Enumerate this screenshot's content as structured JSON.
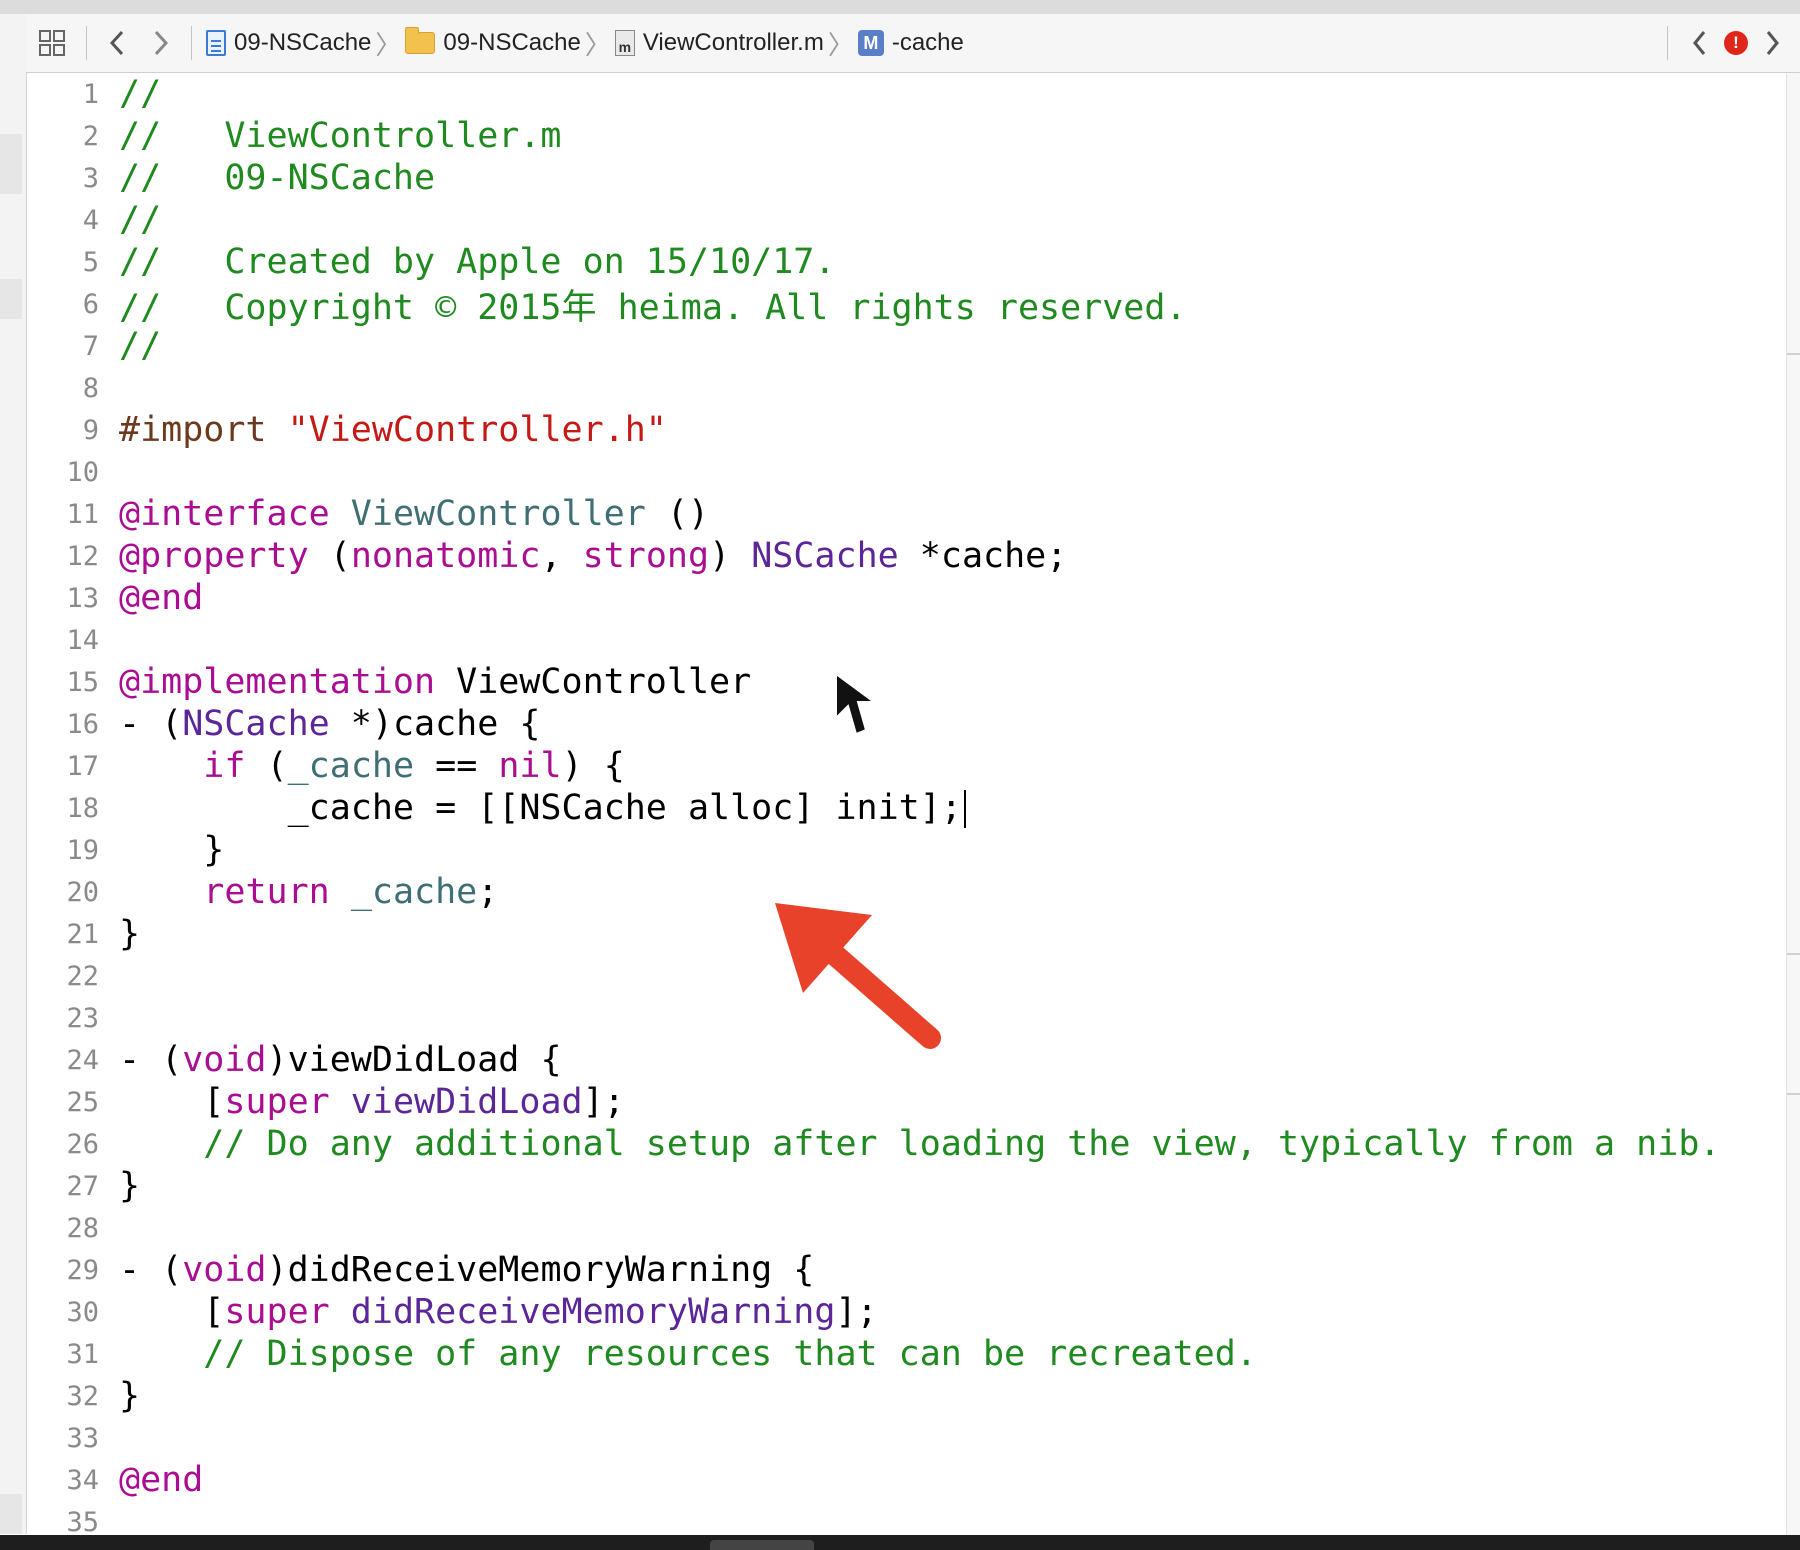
{
  "jumpbar": {
    "crumbs": [
      {
        "label": "09-NSCache",
        "icon": "project-file-icon"
      },
      {
        "label": "09-NSCache",
        "icon": "folder-icon"
      },
      {
        "label": "ViewController.m",
        "icon": "m-file-icon",
        "icon_glyph": "m"
      },
      {
        "label": "-cache",
        "icon": "method-icon",
        "icon_glyph": "M"
      }
    ],
    "error_glyph": "!"
  },
  "editor": {
    "lines": [
      {
        "n": "1",
        "tokens": [
          [
            "com",
            "//"
          ]
        ]
      },
      {
        "n": "2",
        "tokens": [
          [
            "com",
            "//   ViewController.m"
          ]
        ]
      },
      {
        "n": "3",
        "tokens": [
          [
            "com",
            "//   09-NSCache"
          ]
        ]
      },
      {
        "n": "4",
        "tokens": [
          [
            "com",
            "//"
          ]
        ]
      },
      {
        "n": "5",
        "tokens": [
          [
            "com",
            "//   Created by Apple on 15/10/17."
          ]
        ]
      },
      {
        "n": "6",
        "tokens": [
          [
            "com",
            "//   Copyright © 2015年 heima. All rights reserved."
          ]
        ]
      },
      {
        "n": "7",
        "tokens": [
          [
            "com",
            "//"
          ]
        ]
      },
      {
        "n": "8",
        "tokens": []
      },
      {
        "n": "9",
        "tokens": [
          [
            "pre",
            "#import "
          ],
          [
            "str",
            "\"ViewController.h\""
          ]
        ]
      },
      {
        "n": "10",
        "tokens": []
      },
      {
        "n": "11",
        "tokens": [
          [
            "kw",
            "@interface"
          ],
          [
            "",
            " "
          ],
          [
            "type",
            "ViewController"
          ],
          [
            "",
            " ()"
          ]
        ]
      },
      {
        "n": "12",
        "tokens": [
          [
            "kw",
            "@property"
          ],
          [
            "",
            " ("
          ],
          [
            "kw",
            "nonatomic"
          ],
          [
            "",
            ", "
          ],
          [
            "kw",
            "strong"
          ],
          [
            "",
            ") "
          ],
          [
            "cls",
            "NSCache"
          ],
          [
            "",
            " *cache;"
          ]
        ]
      },
      {
        "n": "13",
        "tokens": [
          [
            "kw",
            "@end"
          ]
        ]
      },
      {
        "n": "14",
        "tokens": []
      },
      {
        "n": "15",
        "tokens": [
          [
            "kw",
            "@implementation"
          ],
          [
            "",
            " ViewController"
          ]
        ]
      },
      {
        "n": "16",
        "tokens": [
          [
            "",
            "- ("
          ],
          [
            "cls",
            "NSCache"
          ],
          [
            "",
            " *)cache {"
          ]
        ]
      },
      {
        "n": "17",
        "tokens": [
          [
            "",
            "    "
          ],
          [
            "kw",
            "if"
          ],
          [
            "",
            " ("
          ],
          [
            "ivar",
            "_cache"
          ],
          [
            "",
            " == "
          ],
          [
            "kw",
            "nil"
          ],
          [
            "",
            ") {"
          ]
        ]
      },
      {
        "n": "18",
        "tokens": [
          [
            "",
            "        _cache = [[NSCache alloc] init];"
          ]
        ],
        "caret": true
      },
      {
        "n": "19",
        "tokens": [
          [
            "",
            "    }"
          ]
        ]
      },
      {
        "n": "20",
        "tokens": [
          [
            "",
            "    "
          ],
          [
            "kw",
            "return"
          ],
          [
            "",
            " "
          ],
          [
            "ivar",
            "_cache"
          ],
          [
            "",
            ";"
          ]
        ]
      },
      {
        "n": "21",
        "tokens": [
          [
            "",
            "}"
          ]
        ]
      },
      {
        "n": "22",
        "tokens": []
      },
      {
        "n": "23",
        "tokens": []
      },
      {
        "n": "24",
        "tokens": [
          [
            "",
            "- ("
          ],
          [
            "kw",
            "void"
          ],
          [
            "",
            ")viewDidLoad {"
          ]
        ]
      },
      {
        "n": "25",
        "tokens": [
          [
            "",
            "    ["
          ],
          [
            "kw",
            "super"
          ],
          [
            "",
            " "
          ],
          [
            "cls",
            "viewDidLoad"
          ],
          [
            "",
            "];"
          ]
        ]
      },
      {
        "n": "26",
        "tokens": [
          [
            "",
            "    "
          ],
          [
            "com",
            "// Do any additional setup after loading the view, typically from a nib."
          ]
        ]
      },
      {
        "n": "27",
        "tokens": [
          [
            "",
            "}"
          ]
        ]
      },
      {
        "n": "28",
        "tokens": []
      },
      {
        "n": "29",
        "tokens": [
          [
            "",
            "- ("
          ],
          [
            "kw",
            "void"
          ],
          [
            "",
            ")didReceiveMemoryWarning {"
          ]
        ]
      },
      {
        "n": "30",
        "tokens": [
          [
            "",
            "    ["
          ],
          [
            "kw",
            "super"
          ],
          [
            "",
            " "
          ],
          [
            "cls",
            "didReceiveMemoryWarning"
          ],
          [
            "",
            "];"
          ]
        ]
      },
      {
        "n": "31",
        "tokens": [
          [
            "",
            "    "
          ],
          [
            "com",
            "// Dispose of any resources that can be recreated."
          ]
        ]
      },
      {
        "n": "32",
        "tokens": [
          [
            "",
            "}"
          ]
        ]
      },
      {
        "n": "33",
        "tokens": []
      },
      {
        "n": "34",
        "tokens": [
          [
            "kw",
            "@end"
          ]
        ]
      },
      {
        "n": "35",
        "tokens": []
      }
    ]
  },
  "annotation": {
    "arrow_color": "#e8432a"
  }
}
